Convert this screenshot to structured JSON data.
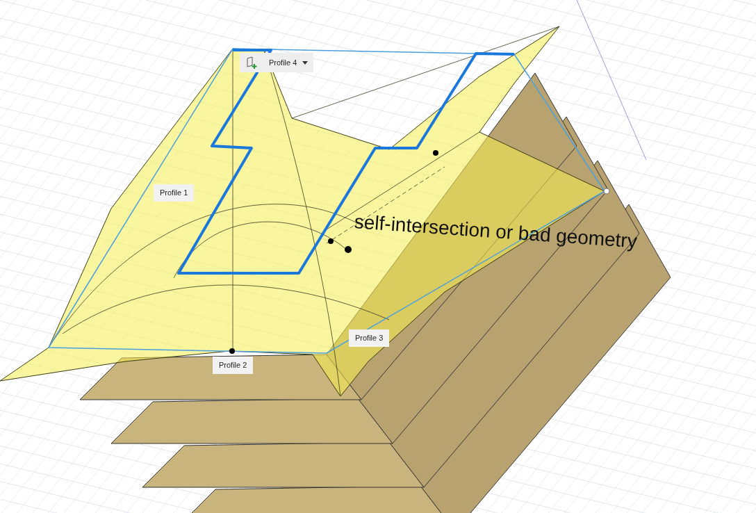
{
  "viewport": {
    "profile_selector": {
      "label": "Profile 4"
    },
    "profile_labels": [
      {
        "text": "Profile 1"
      },
      {
        "text": "Profile 2"
      },
      {
        "text": "Profile 3"
      }
    ],
    "warning": "self-intersection or bad geometry"
  }
}
